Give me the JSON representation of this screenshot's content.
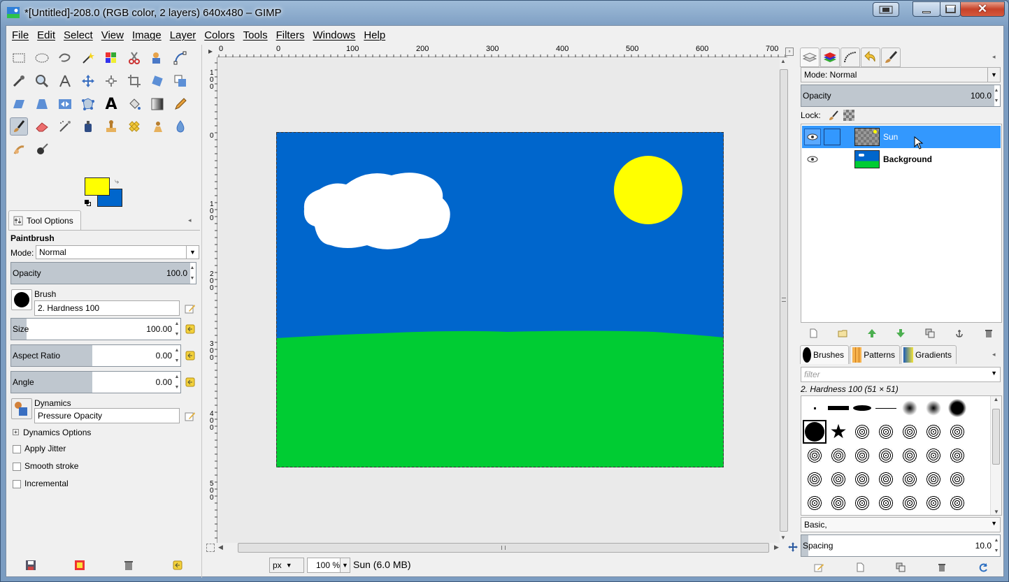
{
  "window": {
    "title": "*[Untitled]-208.0 (RGB color, 2 layers) 640x480 – GIMP"
  },
  "menubar": [
    "File",
    "Edit",
    "Select",
    "View",
    "Image",
    "Layer",
    "Colors",
    "Tools",
    "Filters",
    "Windows",
    "Help"
  ],
  "colors": {
    "foreground": "#ffff00",
    "background": "#0066cc",
    "sky": "#0066cc",
    "grass": "#00cc33",
    "sun": "#ffff00",
    "selection_blue": "#3398fe"
  },
  "tool_options": {
    "tab_label": "Tool Options",
    "tool_name": "Paintbrush",
    "mode_label": "Mode:",
    "mode_value": "Normal",
    "opacity_label": "Opacity",
    "opacity_value": "100.0",
    "brush_label": "Brush",
    "brush_value": "2. Hardness 100",
    "size_label": "Size",
    "size_value": "100.00",
    "aspect_label": "Aspect Ratio",
    "aspect_value": "0.00",
    "angle_label": "Angle",
    "angle_value": "0.00",
    "dynamics_label": "Dynamics",
    "dynamics_value": "Pressure Opacity",
    "dynamics_options": "Dynamics Options",
    "apply_jitter": "Apply Jitter",
    "smooth_stroke": "Smooth stroke",
    "incremental": "Incremental"
  },
  "rulers": {
    "top": [
      "0",
      "0",
      "100",
      "200",
      "300",
      "400",
      "500",
      "600",
      "700"
    ],
    "left": [
      "1\n0\n0",
      "0",
      "1\n0\n0",
      "2\n0\n0",
      "3\n0\n0",
      "4\n0\n0",
      "5\n0\n0"
    ]
  },
  "statusbar": {
    "unit": "px",
    "zoom": "100 %",
    "info": "Sun (6.0 MB)"
  },
  "layers": {
    "mode_label": "Mode: Normal",
    "opacity_label": "Opacity",
    "opacity_value": "100.0",
    "lock_label": "Lock:",
    "items": [
      {
        "name": "Sun",
        "selected": true
      },
      {
        "name": "Background",
        "selected": false
      }
    ]
  },
  "brushes": {
    "tabs": [
      "Brushes",
      "Patterns",
      "Gradients"
    ],
    "filter_placeholder": "filter",
    "current": "2. Hardness 100 (51 × 51)",
    "preset": "Basic,",
    "spacing_label": "Spacing",
    "spacing_value": "10.0"
  }
}
